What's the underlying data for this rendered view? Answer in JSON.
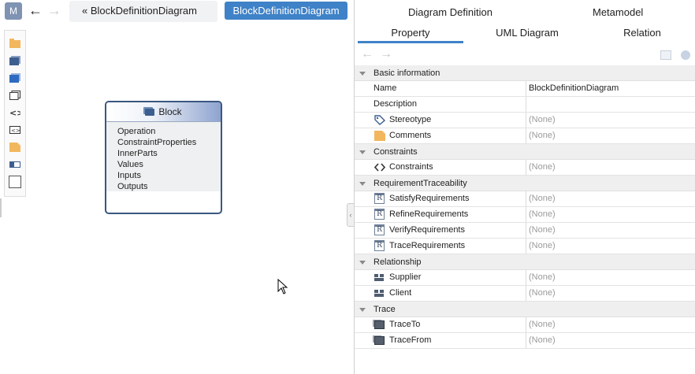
{
  "editor": {
    "model_button": "M",
    "nav_back": "←",
    "nav_forward": "→",
    "breadcrumb": "« BlockDefinitionDiagram",
    "active_tab": "BlockDefinitionDiagram",
    "block": {
      "title": "Block",
      "compartments": [
        "Operation",
        "ConstraintProperties",
        "InnerParts",
        "Values",
        "Inputs",
        "Outputs"
      ]
    }
  },
  "panel": {
    "top_tabs": [
      "Diagram Definition",
      "Metamodel"
    ],
    "sub_tabs": [
      "Property",
      "UML Diagram",
      "Relation"
    ],
    "active_sub_tab": "Property",
    "toolbar": {
      "back": "←",
      "forward": "→"
    },
    "categories": [
      {
        "label": "Basic information",
        "rows": [
          {
            "name": "Name",
            "value": "BlockDefinitionDiagram",
            "icon": ""
          },
          {
            "name": "Description",
            "value": "",
            "icon": ""
          },
          {
            "name": "Stereotype",
            "value": "(None)",
            "icon": "tag-icon"
          },
          {
            "name": "Comments",
            "value": "(None)",
            "icon": "folder-icon"
          }
        ]
      },
      {
        "label": "Constraints",
        "rows": [
          {
            "name": "Constraints",
            "value": "(None)",
            "icon": "code-icon"
          }
        ]
      },
      {
        "label": "RequirementTraceability",
        "rows": [
          {
            "name": "SatisfyRequirements",
            "value": "(None)",
            "icon": "requirement-icon"
          },
          {
            "name": "RefineRequirements",
            "value": "(None)",
            "icon": "requirement-icon"
          },
          {
            "name": "VerifyRequirements",
            "value": "(None)",
            "icon": "requirement-icon"
          },
          {
            "name": "TraceRequirements",
            "value": "(None)",
            "icon": "requirement-icon"
          }
        ]
      },
      {
        "label": "Relationship",
        "rows": [
          {
            "name": "Supplier",
            "value": "(None)",
            "icon": "dependency-icon"
          },
          {
            "name": "Client",
            "value": "(None)",
            "icon": "dependency-icon"
          }
        ]
      },
      {
        "label": "Trace",
        "rows": [
          {
            "name": "TraceTo",
            "value": "(None)",
            "icon": "trace-icon"
          },
          {
            "name": "TraceFrom",
            "value": "(None)",
            "icon": "trace-icon"
          }
        ]
      }
    ]
  },
  "colors": {
    "accent": "#3f82c7",
    "block_border": "#3a5780",
    "none_value": "#9b9b9b"
  }
}
